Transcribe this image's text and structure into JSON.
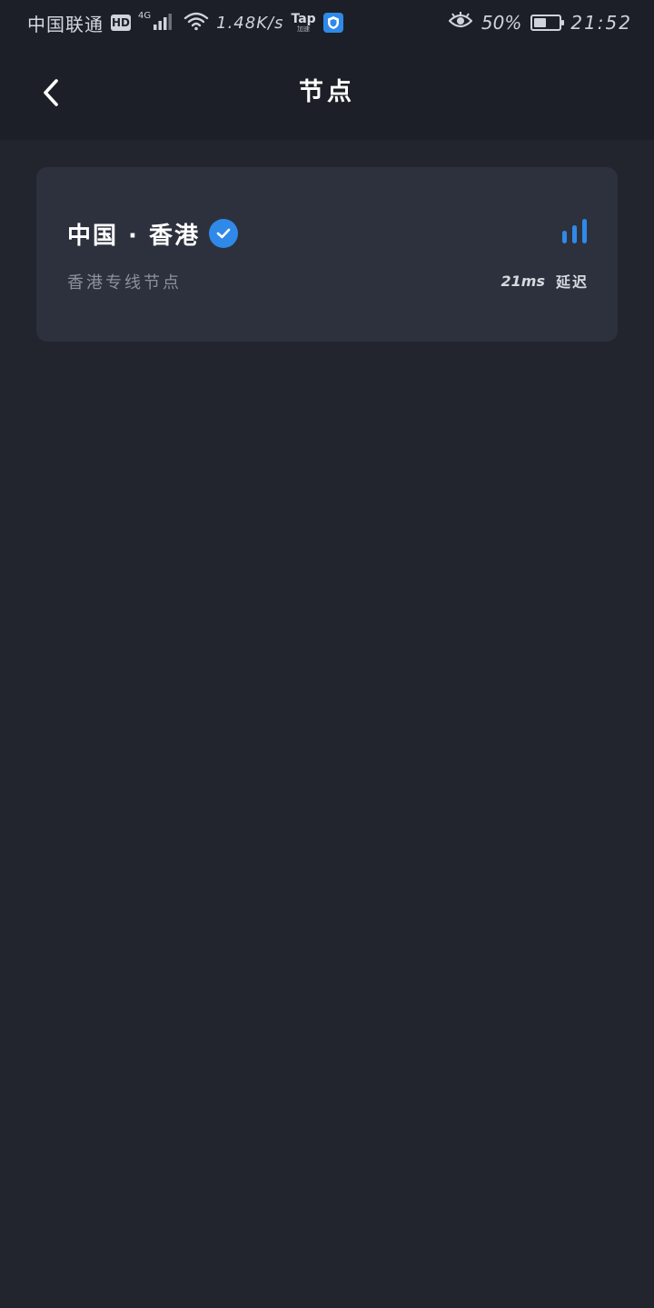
{
  "status_bar": {
    "carrier": "中国联通",
    "hd_badge": "HD",
    "network_type": "4G",
    "speed": "1.48K/s",
    "tap_label": "Tap",
    "tap_sublabel": "加速",
    "battery_percent_text": "50%",
    "battery_level": 0.5,
    "time": "21:52",
    "icons": {
      "signal": "cell-signal-icon",
      "wifi": "wifi-icon",
      "shield": "shield-icon",
      "eye": "eye-comfort-icon",
      "battery": "battery-icon"
    }
  },
  "app_bar": {
    "back_icon": "chevron-left-icon",
    "title": "节点"
  },
  "nodes": [
    {
      "name": "中国 · 香港",
      "selected": true,
      "selected_icon": "check-circle-icon",
      "signal_icon": "signal-bars-icon",
      "description": "香港专线节点",
      "latency_value": "21ms",
      "latency_label": "延迟"
    }
  ],
  "colors": {
    "background": "#22252e",
    "header_background": "#1c1f27",
    "card_background": "#2d313d",
    "accent": "#2f89e8",
    "secondary_text": "#8c919c"
  }
}
